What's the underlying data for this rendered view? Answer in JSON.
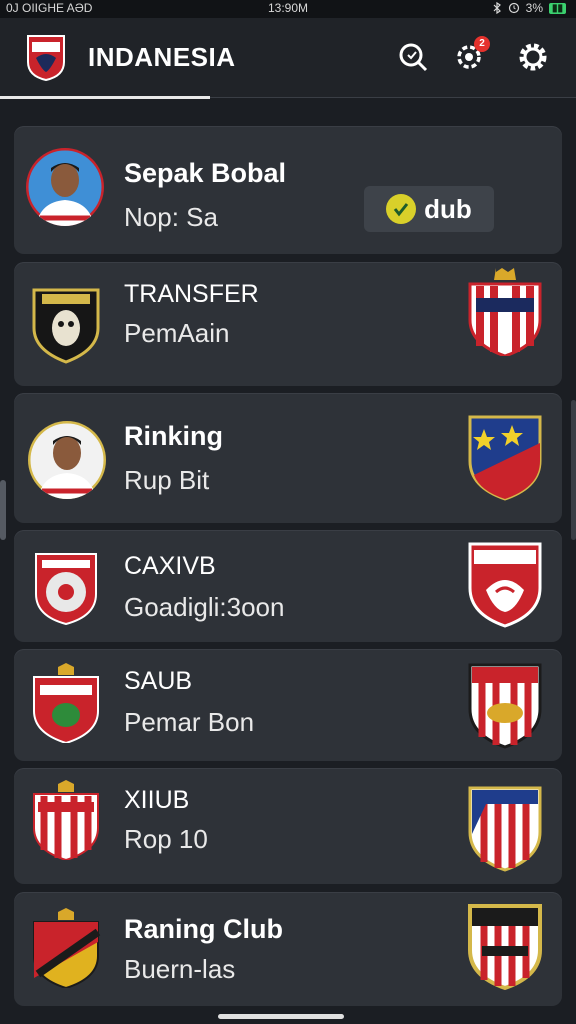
{
  "status_bar": {
    "carrier": "0J OIIGHE AƏD",
    "time": "13:90M",
    "battery": "3%"
  },
  "header": {
    "title": "INDANESIA",
    "notification_count": "2",
    "icons": [
      "club-crest-icon",
      "search-icon",
      "notification-gear-icon",
      "settings-gear-icon"
    ]
  },
  "cards": [
    {
      "title": "Sepak Bobal",
      "subtitle": "Nop: Sa",
      "button_label": "dub",
      "left": "player-avatar",
      "right": "dub-button"
    },
    {
      "title": "TRANSFER",
      "subtitle": "PemAain",
      "left": "crest-black-badge",
      "right": "crest-red-white-shield"
    },
    {
      "title": "Rinking",
      "subtitle": "Rup Bit",
      "left": "player-avatar",
      "right": "crest-blue-red-shield"
    },
    {
      "title": "CAXIVB",
      "subtitle": "Goadigli:3oon",
      "left": "crest-red-circle",
      "right": "crest-red-eagle"
    },
    {
      "title": "SAUB",
      "subtitle": "Pemar Bon",
      "left": "crest-red-green-shield",
      "right": "crest-red-striped-shield"
    },
    {
      "title": "XIIUB",
      "subtitle": "Rop 10",
      "left": "crest-red-striped-crown",
      "right": "crest-blue-striped-shield"
    },
    {
      "title": "Raning Club",
      "subtitle": "Buern-las",
      "left": "crest-red-yellow-shield",
      "right": "crest-gold-striped-shield"
    }
  ],
  "colors": {
    "background": "#1b1e23",
    "card": "#2e3238",
    "accent_red": "#d72a2a",
    "accent_yellow": "#d9d02a"
  }
}
